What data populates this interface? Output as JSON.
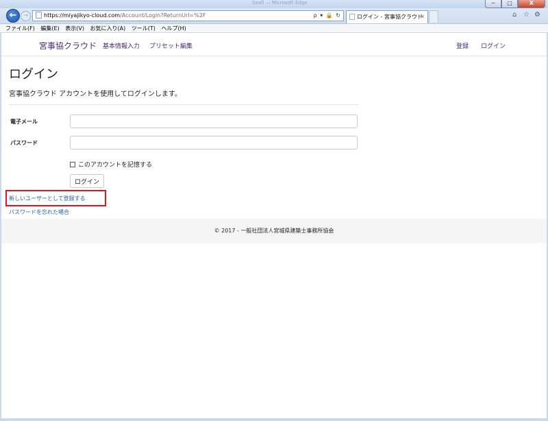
{
  "browser": {
    "faint_title": "Saafi — Microsoft Edge",
    "url_host": "https://miyajikyo-cloud.com",
    "url_path": "/Account/Login?ReturnUrl=%2F",
    "address_tools": "ρ ▾ 🔒 ↻",
    "tab_title": "ログイン - 宮事協クラウド",
    "window_controls": {
      "minimize": "─",
      "maximize": "□",
      "close": "X"
    },
    "toolbar_icons": [
      "home-icon",
      "favorites-star-icon",
      "settings-gear-icon"
    ]
  },
  "menubar": {
    "items": [
      "ファイル(F)",
      "編集(E)",
      "表示(V)",
      "お気に入り(A)",
      "ツール(T)",
      "ヘルプ(H)"
    ]
  },
  "site": {
    "brand": "宮事協クラウド",
    "nav_left": [
      "基本情報入力",
      "プリセット編集"
    ],
    "nav_right": [
      "登録",
      "ログイン"
    ]
  },
  "login": {
    "title": "ログイン",
    "subtitle": "宮事協クラウド アカウントを使用してログインします。",
    "email_label": "電子メール",
    "email_value": "",
    "password_label": "パスワード",
    "password_value": "",
    "remember_label": "このアカウントを記憶する",
    "remember_checked": false,
    "submit_label": "ログイン",
    "register_link": "新しいユーザーとして登録する",
    "forgot_link": "パスワードを忘れた場合"
  },
  "footer": {
    "text": "© 2017 - 一般社団法人宮城県建築士事務所協会"
  },
  "colors": {
    "brand": "#4a2b77",
    "link": "#1d5fb0",
    "highlight": "#e0151b"
  }
}
